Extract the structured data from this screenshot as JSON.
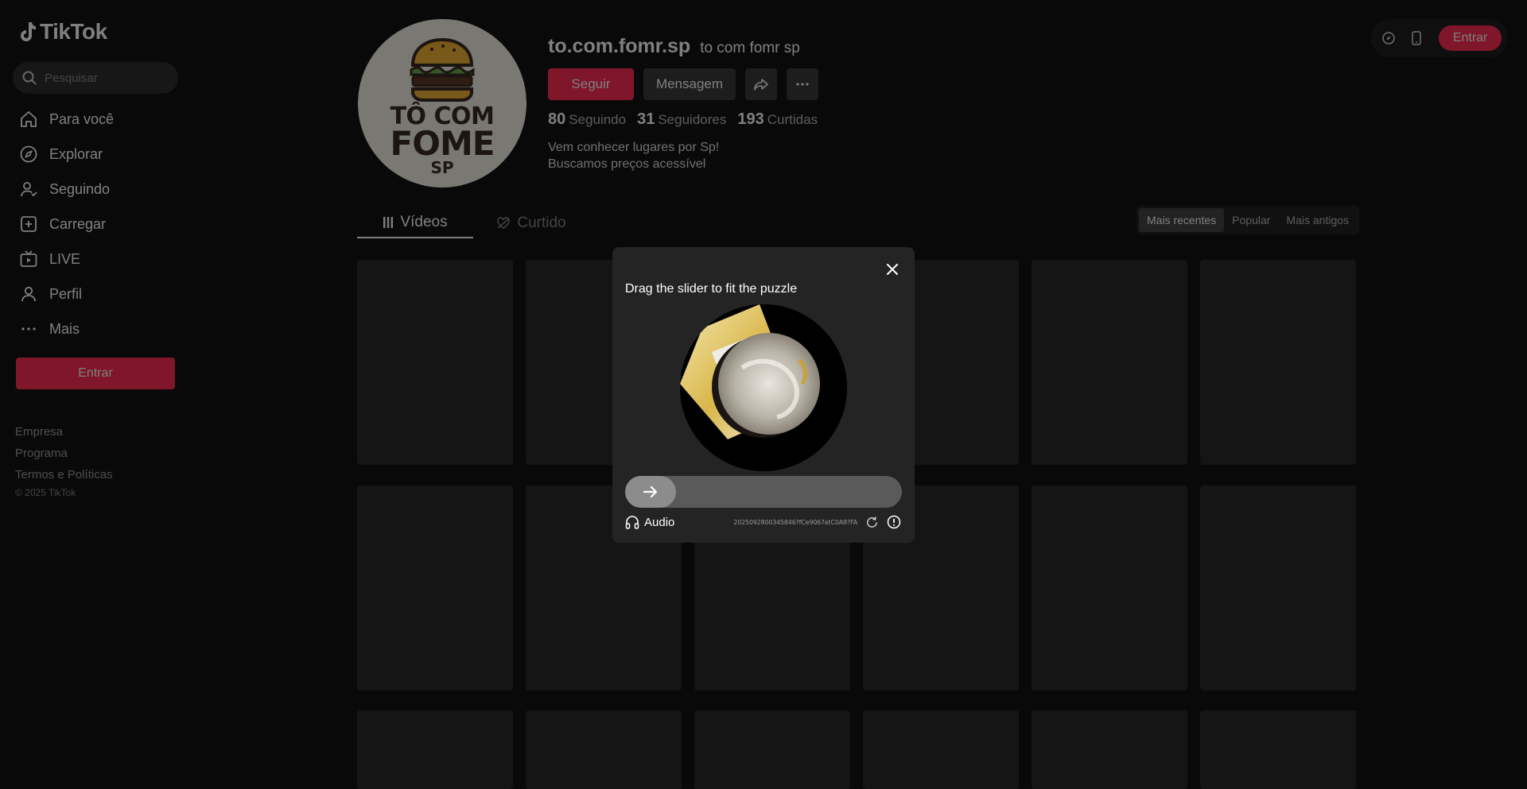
{
  "app": {
    "logo_text": "TikTok"
  },
  "search": {
    "placeholder": "Pesquisar"
  },
  "sidebar": {
    "items": [
      {
        "label": "Para você",
        "icon": "home-icon"
      },
      {
        "label": "Explorar",
        "icon": "compass-icon"
      },
      {
        "label": "Seguindo",
        "icon": "following-icon"
      },
      {
        "label": "Carregar",
        "icon": "upload-icon"
      },
      {
        "label": "LIVE",
        "icon": "live-icon"
      },
      {
        "label": "Perfil",
        "icon": "profile-icon"
      },
      {
        "label": "Mais",
        "icon": "more-icon"
      }
    ],
    "login_label": "Entrar",
    "footer": {
      "company": "Empresa",
      "program": "Programa",
      "terms": "Termos e Políticas",
      "copyright": "© 2025 TikTok"
    }
  },
  "topbar": {
    "login_label": "Entrar"
  },
  "profile": {
    "avatar_text": {
      "line1": "TÔ COM",
      "line2": "FOME",
      "line3": "SP"
    },
    "username": "to.com.fomr.sp",
    "nickname": "to com fomr sp",
    "follow_label": "Seguir",
    "message_label": "Mensagem",
    "stats": {
      "following_count": "80",
      "following_label": "Seguindo",
      "followers_count": "31",
      "followers_label": "Seguidores",
      "likes_count": "193",
      "likes_label": "Curtidas"
    },
    "bio": {
      "line1": "Vem conhecer lugares por Sp!",
      "line2": "Buscamos preços acessível"
    }
  },
  "tabs": {
    "videos": "Vídeos",
    "liked": "Curtido"
  },
  "sort": {
    "recent": "Mais recentes",
    "popular": "Popular",
    "oldest": "Mais antigos",
    "selected": "Mais recentes"
  },
  "captcha": {
    "title": "Drag the slider to fit the puzzle",
    "audio_label": "Audio",
    "id": "2025092800345846?fCe9067etC0A8?FA",
    "slider_progress": 0
  },
  "colors": {
    "accent": "#fe2c55",
    "background": "#121212",
    "modal": "#242424"
  }
}
